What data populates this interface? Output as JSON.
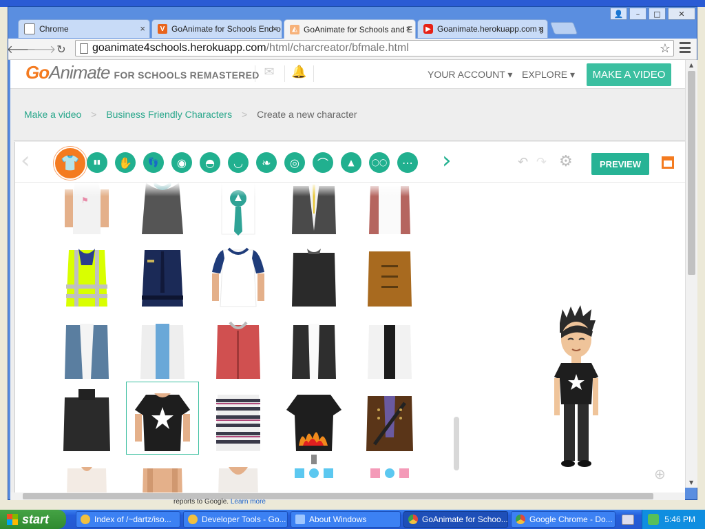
{
  "browser": {
    "tabs": [
      {
        "label": "Chrome",
        "icon": "page-icon",
        "active": false
      },
      {
        "label": "GoAnimate for Schools End-o",
        "icon": "v-icon",
        "active": false
      },
      {
        "label": "GoAnimate for Schools and E",
        "icon": "goanimate-icon",
        "active": true
      },
      {
        "label": "Goanimate.herokuapp.com g",
        "icon": "youtube-icon",
        "active": false
      }
    ],
    "close_glyph": "×",
    "window_buttons": {
      "user": "👤",
      "minimize": "–",
      "maximize": "□",
      "close": "✕"
    },
    "url_host": "goanimate4schools.herokuapp.com",
    "url_path": "/html/charcreator/bfmale.html"
  },
  "site": {
    "logo_go": "Go",
    "logo_animate": "Animate",
    "logo_sub": "FOR SCHOOLS REMASTERED",
    "nav": {
      "account": "YOUR ACCOUNT ▾",
      "explore": "EXPLORE ▾"
    },
    "make_video": "MAKE A VIDEO"
  },
  "breadcrumb": {
    "items": [
      "Make a video",
      "Business Friendly Characters"
    ],
    "separator": ">",
    "current": "Create a new character"
  },
  "editor": {
    "categories": [
      {
        "name": "upper-body",
        "glyph": "👕",
        "active": true
      },
      {
        "name": "lower-body",
        "glyph": "▮▮"
      },
      {
        "name": "hands",
        "glyph": "✋"
      },
      {
        "name": "shoes",
        "glyph": "👣"
      },
      {
        "name": "face-shape",
        "glyph": "◉"
      },
      {
        "name": "hair",
        "glyph": "◓"
      },
      {
        "name": "mouth",
        "glyph": "◡"
      },
      {
        "name": "ears",
        "glyph": "❧"
      },
      {
        "name": "eyes",
        "glyph": "◎"
      },
      {
        "name": "eyebrows",
        "glyph": "⌒"
      },
      {
        "name": "nose",
        "glyph": "▲"
      },
      {
        "name": "glasses",
        "glyph": "◯◯"
      },
      {
        "name": "facial-hair",
        "glyph": "⋯"
      }
    ],
    "prev_glyph": "‹",
    "next_glyph": "›",
    "undo_glyph": "↶",
    "redo_glyph": "↷",
    "settings_glyph": "⚙",
    "preview_label": "PREVIEW",
    "zoom_glyph": "⊕",
    "selected_item": "black-star-tshirt",
    "grid_items": [
      [
        "white-ribbon-tshirt",
        "gray-hoodie",
        "shirt-teal-tie",
        "gray-suit-yellow-tie",
        "red-apron"
      ],
      [
        "hi-vis-vest",
        "police-uniform",
        "white-raglan-tee",
        "black-jacket",
        "brown-duffle-coat"
      ],
      [
        "blue-open-blazer",
        "white-jacket-blue-shirt",
        "red-hoodie",
        "black-blazer-white-shirt",
        "white-jacket-black-shirt"
      ],
      [
        "black-turtleneck",
        "black-star-tshirt",
        "striped-sweater",
        "black-flame-tshirt",
        "brown-steampunk-coat"
      ]
    ]
  },
  "status_tip": {
    "text": "reports to Google. ",
    "link": "Learn more"
  },
  "taskbar": {
    "start_label": "start",
    "tasks": [
      {
        "label": "Index of /~dartz/iso...",
        "color": "#f0c040"
      },
      {
        "label": "Developer Tools - Go...",
        "color": "#f0c040"
      },
      {
        "label": "About Windows",
        "color": "#9ec6ff"
      },
      {
        "label": "GoAnimate for Schoo...",
        "color": "#e04a3a",
        "active": true
      },
      {
        "label": "Google Chrome - Do...",
        "color": "#e04a3a"
      }
    ],
    "clock": "5:46 PM"
  }
}
